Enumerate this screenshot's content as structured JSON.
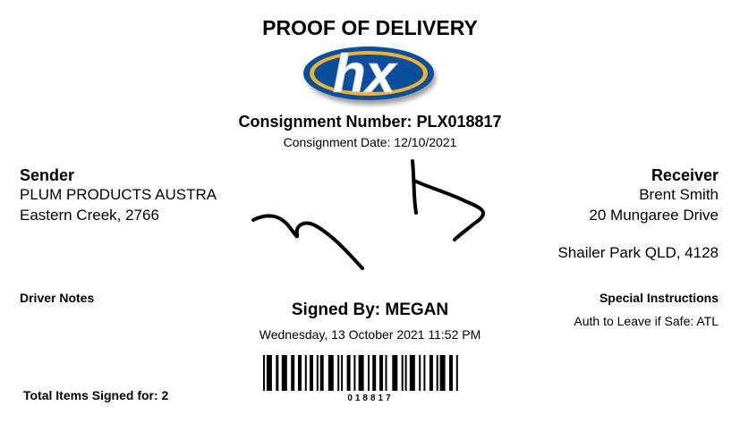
{
  "title": "PROOF OF DELIVERY",
  "logo": {
    "text": "hx",
    "colors": {
      "blue": "#0a4f9e",
      "gold": "#f0b030"
    }
  },
  "consignment": {
    "number_label": "Consignment Number: PLX018817",
    "date_label": "Consignment Date: 12/10/2021"
  },
  "sender": {
    "heading": "Sender",
    "line1": "PLUM PRODUCTS AUSTRA",
    "line2": "Eastern Creek, 2766"
  },
  "receiver": {
    "heading": "Receiver",
    "name": "Brent Smith",
    "street": "20 Mungaree Drive",
    "city": "Shailer Park QLD, 4128"
  },
  "driver_notes": {
    "heading": "Driver Notes"
  },
  "special_instructions": {
    "heading": "Special Instructions",
    "text": "Auth to Leave if Safe: ATL"
  },
  "signed": {
    "label": "Signed By: MEGAN",
    "datetime": "Wednesday, 13 October 2021 11:52 PM"
  },
  "barcode": {
    "value": "018817"
  },
  "total_items": "Total Items Signed for: 2"
}
